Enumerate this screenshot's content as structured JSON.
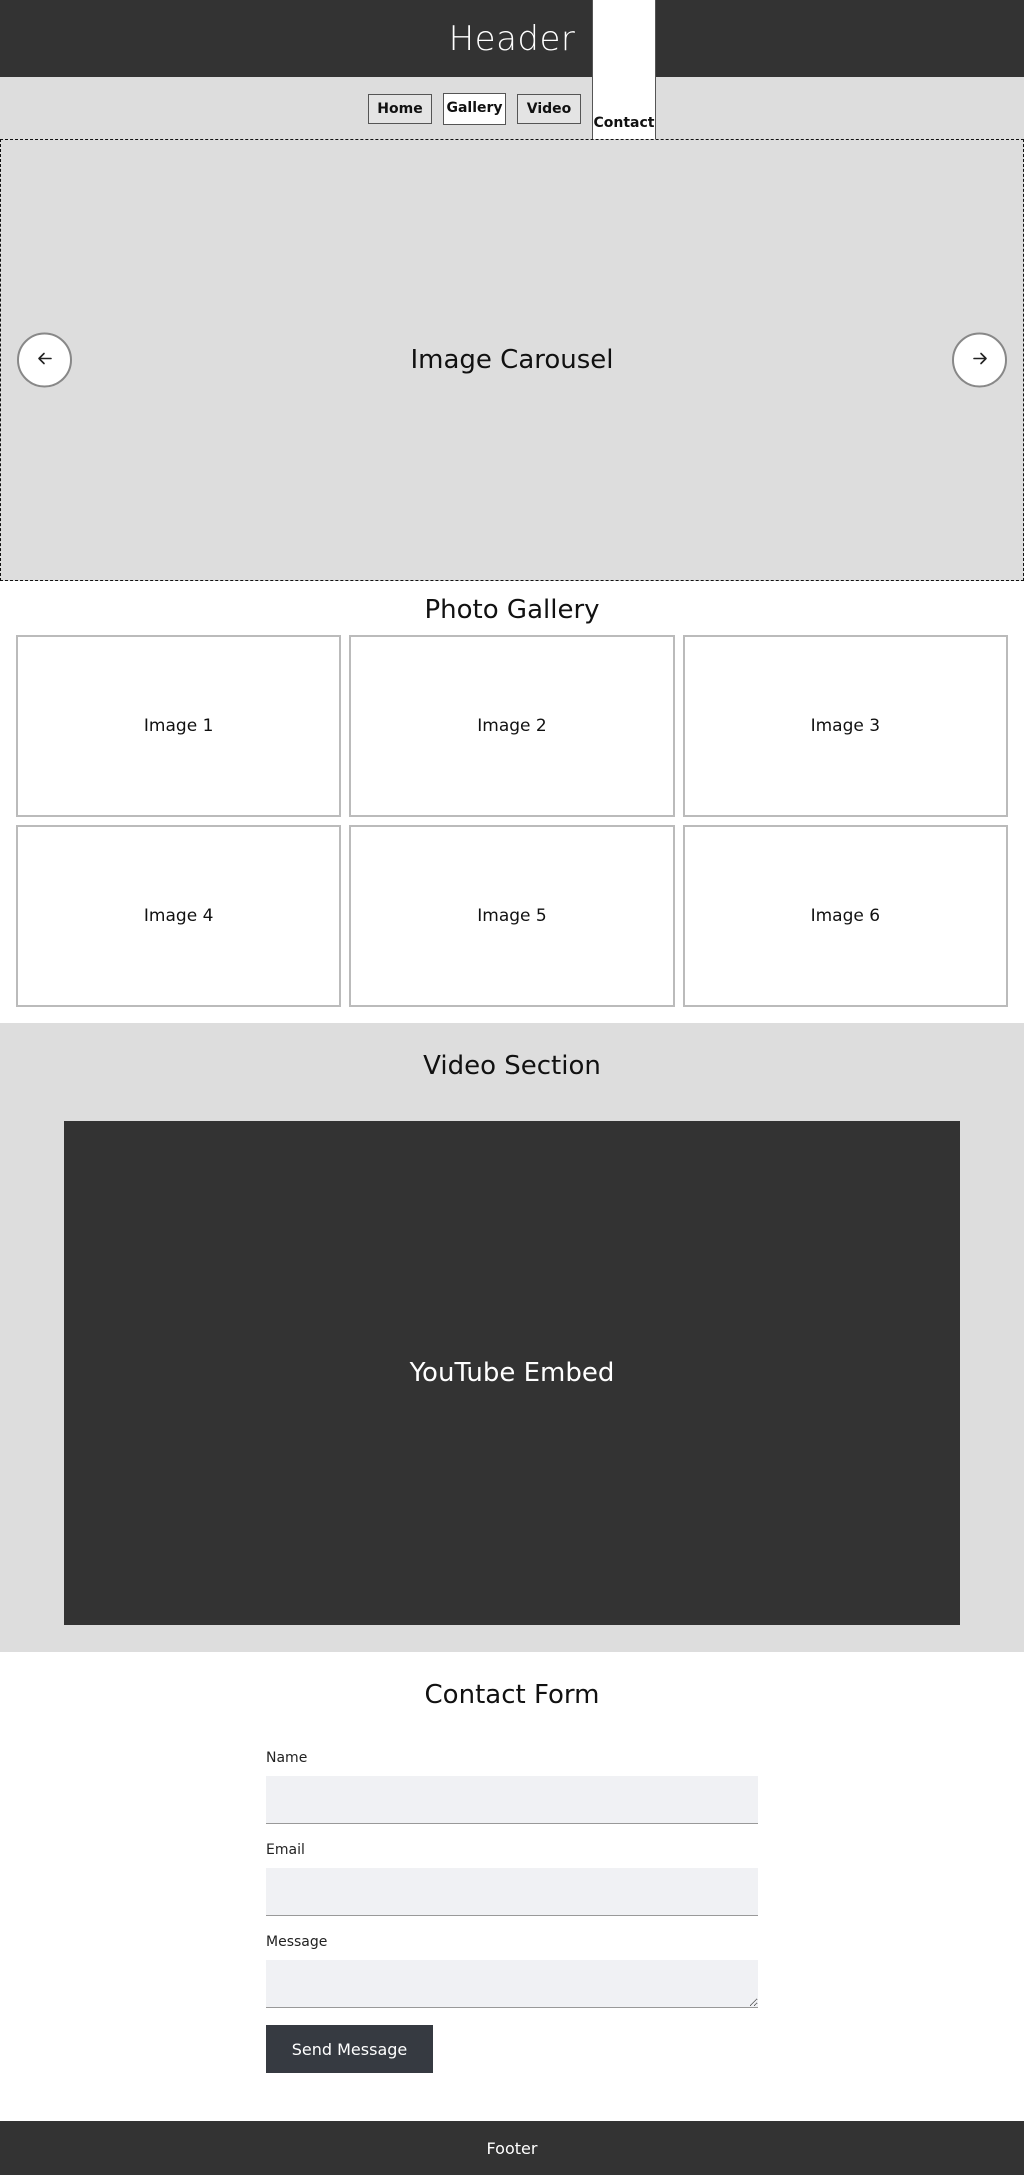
{
  "header": {
    "title": "Header"
  },
  "nav": {
    "items": [
      {
        "label": "Home"
      },
      {
        "label": "Gallery"
      },
      {
        "label": "Video"
      },
      {
        "label": "Contact"
      }
    ]
  },
  "carousel": {
    "label": "Image Carousel",
    "prev_icon": "arrow-left-icon",
    "next_icon": "arrow-right-icon"
  },
  "gallery": {
    "title": "Photo Gallery",
    "images": [
      {
        "label": "Image 1"
      },
      {
        "label": "Image 2"
      },
      {
        "label": "Image 3"
      },
      {
        "label": "Image 4"
      },
      {
        "label": "Image 5"
      },
      {
        "label": "Image 6"
      }
    ]
  },
  "video": {
    "title": "Video Section",
    "embed_label": "YouTube Embed"
  },
  "contact": {
    "title": "Contact Form",
    "fields": {
      "name_label": "Name",
      "name_value": "",
      "email_label": "Email",
      "email_value": "",
      "message_label": "Message",
      "message_value": ""
    },
    "submit_label": "Send Message"
  },
  "footer": {
    "text": "Footer"
  },
  "colors": {
    "header_bg": "#333333",
    "nav_bg": "#dddddd",
    "video_embed_bg": "#333333",
    "input_bg": "#f0f1f4",
    "submit_bg": "#363a41"
  }
}
